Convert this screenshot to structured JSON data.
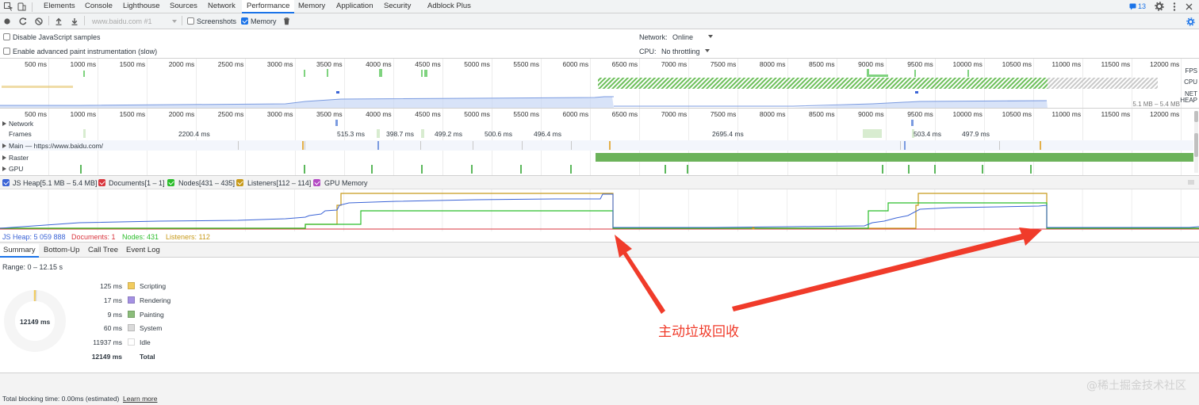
{
  "devtools": {
    "tabs": [
      "Elements",
      "Console",
      "Lighthouse",
      "Sources",
      "Network",
      "Performance",
      "Memory",
      "Application",
      "Security",
      "Adblock Plus"
    ],
    "active_tab": "Performance",
    "issues_count": "13"
  },
  "toolbar": {
    "profile_select": "www.baidu.com #1",
    "screenshots_label": "Screenshots",
    "screenshots_checked": false,
    "memory_label": "Memory",
    "memory_checked": true
  },
  "settings": {
    "disable_js_samples": "Disable JavaScript samples",
    "enable_paint_instrumentation": "Enable advanced paint instrumentation (slow)",
    "network_label": "Network:",
    "network_value": "Online",
    "cpu_label": "CPU:",
    "cpu_value": "No throttling"
  },
  "overview": {
    "ticks": [
      "500 ms",
      "1000 ms",
      "1500 ms",
      "2000 ms",
      "2500 ms",
      "3000 ms",
      "3500 ms",
      "4000 ms",
      "4500 ms",
      "5000 ms",
      "5500 ms",
      "6000 ms",
      "6500 ms",
      "7000 ms",
      "7500 ms",
      "8000 ms",
      "8500 ms",
      "9000 ms",
      "9500 ms",
      "10000 ms",
      "10500 ms",
      "11000 ms",
      "11500 ms",
      "12000 ms"
    ],
    "lane_labels": [
      "FPS",
      "CPU",
      "NET",
      "HEAP"
    ],
    "heap_range": "5.1 MB – 5.4 MB"
  },
  "tracks": {
    "network": "Network",
    "frames": "Frames",
    "main": "Main — https://www.baidu.com/",
    "raster": "Raster",
    "gpu": "GPU",
    "frame_times": [
      "2200.4 ms",
      "515.3 ms",
      "398.7 ms",
      "499.2 ms",
      "500.6 ms",
      "496.4 ms",
      "2695.4 ms",
      "503.4 ms",
      "497.9 ms"
    ]
  },
  "memory_legend": {
    "items": [
      {
        "label": "JS Heap[5.1 MB – 5.4 MB]",
        "color": "#3b64d6"
      },
      {
        "label": "Documents[1 – 1]",
        "color": "#d9363e"
      },
      {
        "label": "Nodes[431 – 435]",
        "color": "#2bbd2b"
      },
      {
        "label": "Listeners[112 – 114]",
        "color": "#c89a1a"
      },
      {
        "label": "GPU Memory",
        "color": "#b44bc4"
      }
    ],
    "values": {
      "js_heap": "JS Heap: 5 059 888",
      "documents": "Documents: 1",
      "nodes": "Nodes: 431",
      "listeners": "Listeners: 112"
    }
  },
  "bottom_tabs": [
    "Summary",
    "Bottom-Up",
    "Call Tree",
    "Event Log"
  ],
  "summary": {
    "range": "Range: 0 – 12.15 s",
    "donut_label": "12149 ms",
    "rows": [
      {
        "value": "125 ms",
        "label": "Scripting",
        "color": "#f2cc5e"
      },
      {
        "value": "17 ms",
        "label": "Rendering",
        "color": "#a591e3"
      },
      {
        "value": "9 ms",
        "label": "Painting",
        "color": "#8bbd7a"
      },
      {
        "value": "60 ms",
        "label": "System",
        "color": "#dadada"
      },
      {
        "value": "11937 ms",
        "label": "Idle",
        "color": "#ffffff"
      }
    ],
    "total_value": "12149 ms",
    "total_label": "Total"
  },
  "footer": {
    "blocking": "Total blocking time: 0.00ms (estimated)",
    "learn_more": "Learn more"
  },
  "annotation": {
    "text": "主动垃圾回收",
    "color": "#f03b2a"
  },
  "watermark": "@稀土掘金技术社区"
}
